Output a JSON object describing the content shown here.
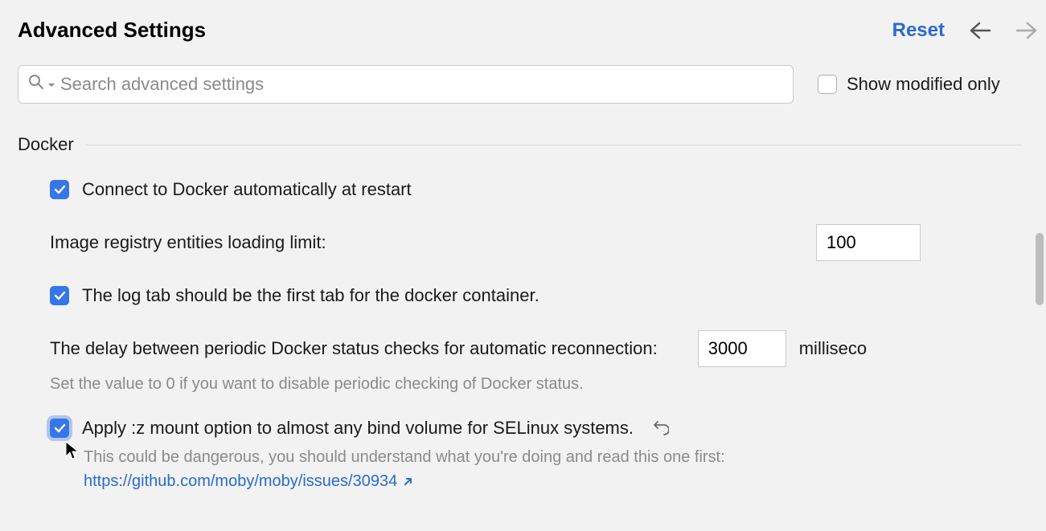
{
  "header": {
    "title": "Advanced Settings",
    "reset": "Reset"
  },
  "search": {
    "placeholder": "Search advanced settings",
    "show_modified_label": "Show modified only",
    "show_modified_checked": false
  },
  "section": {
    "name": "Docker"
  },
  "docker": {
    "connect_auto": {
      "checked": true,
      "label": "Connect to Docker automatically at restart"
    },
    "registry_limit": {
      "label": "Image registry entities loading limit:",
      "value": "100"
    },
    "log_first": {
      "checked": true,
      "label": "The log tab should be the first tab for the docker container."
    },
    "status_delay": {
      "label": "The delay between periodic Docker status checks for automatic reconnection:",
      "value": "3000",
      "unit": "milliseco",
      "hint": "Set the value to 0 if you want to disable periodic checking of Docker status."
    },
    "selinux": {
      "checked": true,
      "label": "Apply :z mount option to almost any bind volume for SELinux systems.",
      "desc": "This could be dangerous, you should understand what you're doing and read this one first:",
      "link": "https://github.com/moby/moby/issues/30934"
    }
  }
}
